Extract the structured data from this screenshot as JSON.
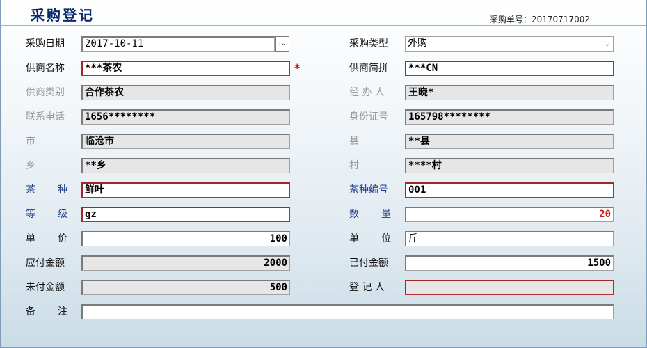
{
  "header": {
    "title": "采购登记",
    "order_label": "采购单号：20170717002"
  },
  "icons": {
    "date_spin": "date-spin-icon",
    "dropdown": "chevron-down-icon"
  },
  "colors": {
    "title": "#0b2a6e",
    "required_border": "#b03030",
    "required_star": "#d01818",
    "quantity_text": "#d11a1a"
  },
  "left": {
    "purchase_date": {
      "label": "采购日期",
      "value": "2017-10-11",
      "spin": ":⌄"
    },
    "supplier_name": {
      "label": "供商名称",
      "value": "***茶农",
      "star": "*"
    },
    "supplier_type": {
      "label": "供商类别",
      "value": "合作茶农"
    },
    "phone": {
      "label": "联系电话",
      "value": "1656********"
    },
    "city": {
      "label": "市",
      "value": "临沧市"
    },
    "township": {
      "label": "乡",
      "value": "**乡"
    },
    "tea_type": {
      "label": "茶种",
      "value": "鲜叶"
    },
    "grade": {
      "label": "等级",
      "value": "gz"
    },
    "unit_price": {
      "label": "单价",
      "value": "100"
    },
    "payable": {
      "label": "应付金额",
      "value": "2000"
    },
    "unpaid": {
      "label": "未付金额",
      "value": "500"
    },
    "remark": {
      "label": "备注",
      "value": ""
    }
  },
  "right": {
    "purchase_type": {
      "label": "采购类型",
      "value": "外购"
    },
    "supplier_abbr": {
      "label": "供商简拼",
      "value": "***CN"
    },
    "handler": {
      "label": "经 办 人",
      "value": "王晓*"
    },
    "id_number": {
      "label": "身份证号",
      "value": "165798********"
    },
    "county": {
      "label": "县",
      "value": "**县"
    },
    "village": {
      "label": "村",
      "value": "****村"
    },
    "tea_code": {
      "label": "茶种编号",
      "value": "001"
    },
    "quantity": {
      "label": "数量",
      "value": "20"
    },
    "unit": {
      "label": "单位",
      "value": "斤"
    },
    "paid": {
      "label": "已付金额",
      "value": "1500"
    },
    "registrar": {
      "label": "登 记 人",
      "value": ""
    }
  }
}
